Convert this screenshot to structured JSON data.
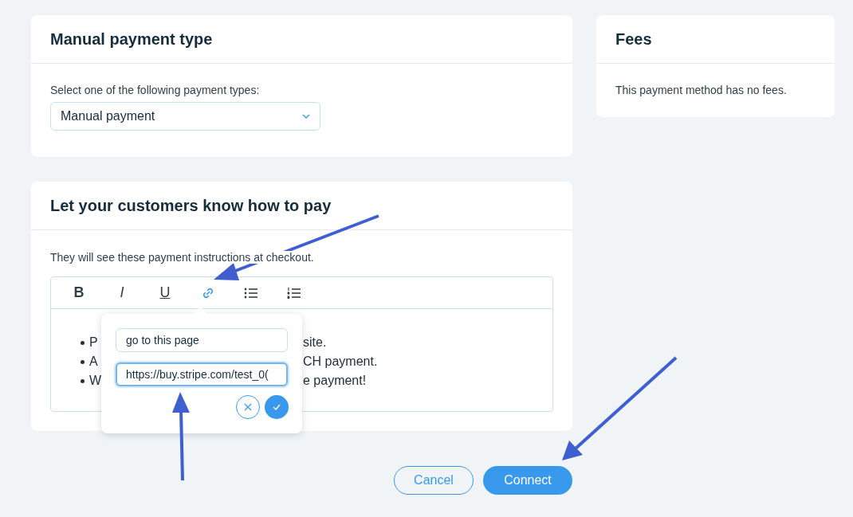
{
  "type_card": {
    "title": "Manual payment type",
    "label": "Select one of the following payment types:",
    "select_value": "Manual payment"
  },
  "fees_card": {
    "title": "Fees",
    "text": "This payment method has no fees."
  },
  "instructions_card": {
    "title": "Let your customers know how to pay",
    "text": "They will see these payment instructions at checkout.",
    "toolbar": [
      {
        "kind": "bold",
        "glyph": "B",
        "selected": false
      },
      {
        "kind": "italic",
        "glyph": "I",
        "selected": false
      },
      {
        "kind": "underline",
        "glyph": "U",
        "selected": false
      },
      {
        "kind": "link",
        "selected": true
      },
      {
        "kind": "bullets",
        "selected": false
      },
      {
        "kind": "numbers",
        "selected": false
      }
    ],
    "bullets": [
      {
        "start": "P",
        "end": "site."
      },
      {
        "start": "A",
        "end": "CH payment."
      },
      {
        "start": "W",
        "end": "e payment!"
      }
    ],
    "link_popup": {
      "text_value": "go to this page",
      "url_value": "https://buy.stripe.com/test_0("
    }
  },
  "buttons": [
    {
      "kind": "secondary",
      "label": "Cancel"
    },
    {
      "kind": "primary",
      "label": "Connect"
    }
  ]
}
